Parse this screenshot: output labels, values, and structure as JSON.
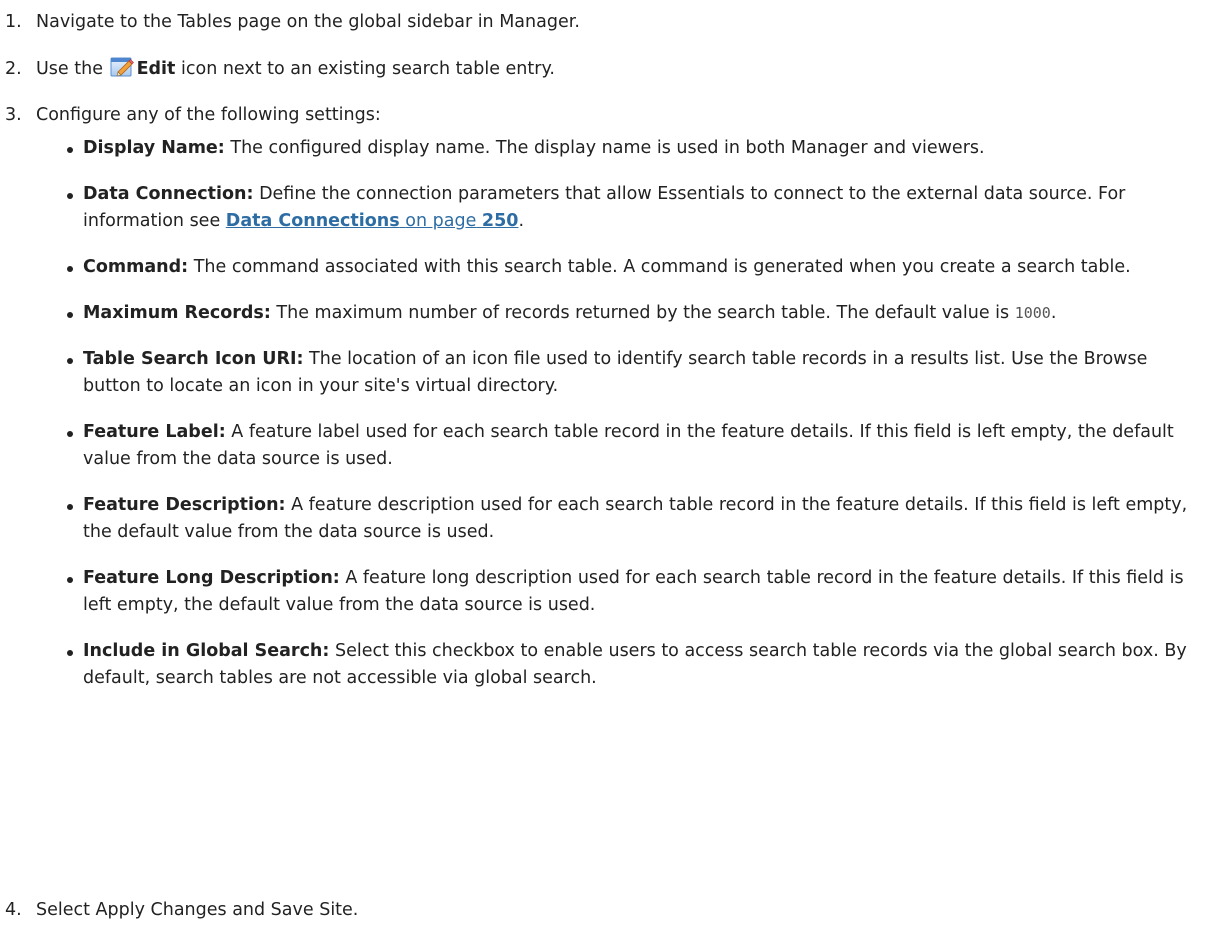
{
  "steps": [
    {
      "num": "1.",
      "text": "Navigate to the Tables page on the global sidebar in Manager."
    },
    {
      "num": "2.",
      "pre": "Use the",
      "bold": "Edit",
      "post": "icon next to an existing search table entry."
    },
    {
      "num": "3.",
      "text": "Configure any of the following settings:"
    },
    {
      "num": "4.",
      "text": "Select Apply Changes and Save Site."
    }
  ],
  "settings": [
    {
      "term": "Display Name:",
      "desc": "The configured display name. The display name is used in both Manager and viewers."
    },
    {
      "term": "Data Connection:",
      "desc": "Define the connection parameters that allow Essentials to connect to the external data source. For information see",
      "link_title": "Data Connections",
      "link_mid": "on page",
      "link_page": "250",
      "tail": "."
    },
    {
      "term": "Command:",
      "desc": "The command associated with this search table. A command is generated when you create a search table."
    },
    {
      "term": "Maximum Records:",
      "desc": "The maximum number of records returned by the search table. The default value is",
      "code": "1000",
      "tail": "."
    },
    {
      "term": "Table Search Icon URI:",
      "desc": "The location of an icon file used to identify search table records in a results list. Use the Browse button to locate an icon in your site's virtual directory."
    },
    {
      "term": "Feature Label:",
      "desc": "A feature label used for each search table record in the feature details. If this field is left empty, the default value from the data source is used."
    },
    {
      "term": "Feature Description:",
      "desc": "A feature description used for each search table record in the feature details. If this field is left empty, the default value from the data source is used."
    },
    {
      "term": "Feature Long Description:",
      "desc": "A feature long description used for each search table record in the feature details. If this field is left empty, the default value from the data source is used."
    },
    {
      "term": "Include in Global Search:",
      "desc": "Select this checkbox to enable users to access search table records via the global search box. By default, search tables are not accessible via global search."
    }
  ],
  "icons": {
    "edit": "edit-pencil-icon"
  },
  "colors": {
    "text": "#222222",
    "link": "#2e6da4",
    "code": "#555555"
  }
}
